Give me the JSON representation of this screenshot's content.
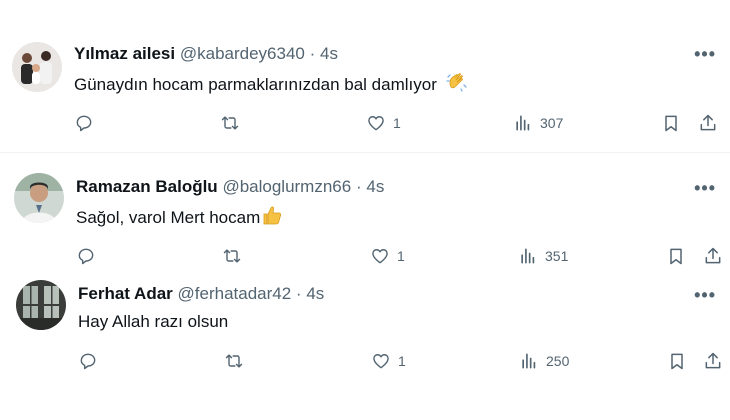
{
  "tweets": [
    {
      "name": "Yılmaz ailesi",
      "handle": "@kabardey6340",
      "separator": "·",
      "time": "4s",
      "text": "Günaydın hocam parmaklarınızdan bal damlıyor",
      "emoji": "waving-hand-icon",
      "likes": "1",
      "views": "307"
    },
    {
      "name": "Ramazan Baloğlu",
      "handle": "@baloglurmzn66",
      "separator": "·",
      "time": "4s",
      "text": "Sağol, varol Mert hocam",
      "emoji": "thumbs-up-icon",
      "likes": "1",
      "views": "351"
    },
    {
      "name": "Ferhat Adar",
      "handle": "@ferhatadar42",
      "separator": "·",
      "time": "4s",
      "text": "Hay Allah razı olsun",
      "likes": "1",
      "views": "250"
    }
  ],
  "more_label": "•••",
  "colors": {
    "text": "#0f1419",
    "secondary": "#536471",
    "divider": "#eff3f4",
    "emoji": "#f6c244"
  }
}
